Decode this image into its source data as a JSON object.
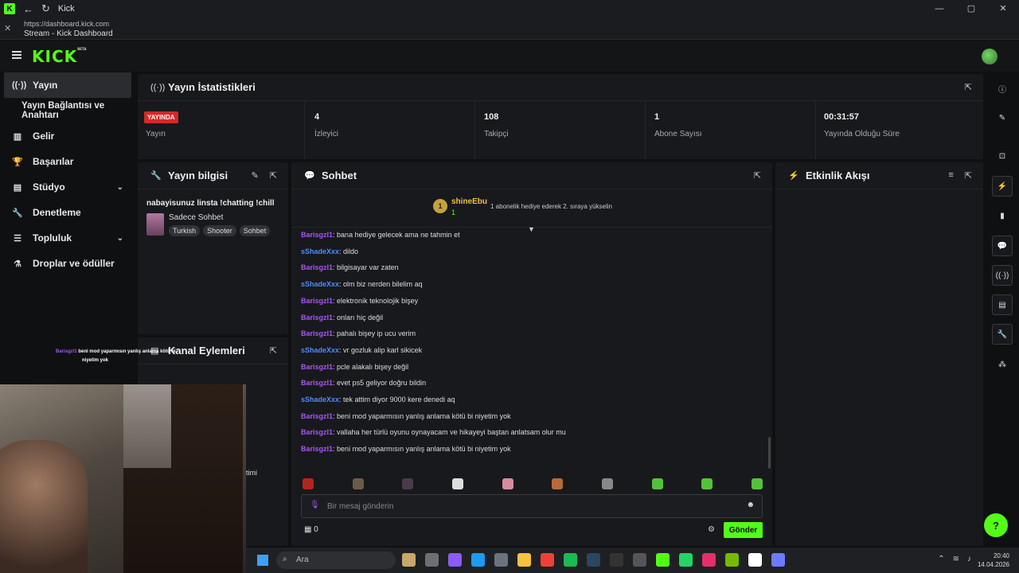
{
  "window": {
    "app_name": "Kick",
    "url": "https://dashboard.kick.com",
    "page_title": "Stream - Kick Dashboard",
    "nav_back": "←",
    "nav_refresh": "↻",
    "close_tab": "✕",
    "btn_min": "—",
    "btn_max": "▢",
    "btn_close": "✕"
  },
  "header": {
    "logo": "KICK",
    "logo_badge": "BETA"
  },
  "sidebar": {
    "items": [
      {
        "icon": "broadcast-icon",
        "glyph": "((·))",
        "label": "Yayın",
        "active": true
      },
      {
        "icon": "",
        "glyph": "",
        "label": "Yayın Bağlantısı ve Anahtarı"
      },
      {
        "icon": "chart-icon",
        "glyph": "▥",
        "label": "Gelir"
      },
      {
        "icon": "trophy-icon",
        "glyph": "🏆",
        "label": "Başarılar"
      },
      {
        "icon": "studio-icon",
        "glyph": "▤",
        "label": "Stüdyo",
        "chevron": "⌄"
      },
      {
        "icon": "wrench-icon",
        "glyph": "🔧",
        "label": "Denetleme"
      },
      {
        "icon": "community-icon",
        "glyph": "☰",
        "label": "Topluluk",
        "chevron": "⌄"
      },
      {
        "icon": "drops-icon",
        "glyph": "⚗",
        "label": "Droplar ve ödüller"
      }
    ]
  },
  "stats_panel": {
    "title": "Yayın İstatistikleri",
    "live_badge": "YAYINDA",
    "stats": [
      {
        "value": "",
        "label": "Yayın"
      },
      {
        "value": "4",
        "label": "İzleyici"
      },
      {
        "value": "108",
        "label": "Takipçi"
      },
      {
        "value": "1",
        "label": "Abone Sayısı"
      },
      {
        "value": "00:31:57",
        "label": "Yayında Olduğu Süre"
      }
    ]
  },
  "info_panel": {
    "title": "Yayın bilgisi",
    "stream_title": "nabayisunuz linsta !chatting !chill",
    "category": "Sadece Sohbet",
    "tags": [
      "Turkish",
      "Shooter",
      "Sohbet"
    ]
  },
  "actions_panel": {
    "title": "Kanal Eylemleri",
    "partial_item": "timi"
  },
  "chat": {
    "title": "Sohbet",
    "pinned": {
      "badge": "1",
      "user": "shineEbu",
      "count": "1",
      "text": "1 abonelik hediye ederek 2. sıraya yükselin"
    },
    "messages": [
      {
        "user": "Barisgzl1",
        "color": "#a855f7",
        "text": "bana hediye gelecek ama ne tahmin et"
      },
      {
        "user": "sShadeXxx",
        "color": "#4f8cff",
        "text": "dildo"
      },
      {
        "user": "Barisgzl1",
        "color": "#a855f7",
        "text": "bilgisayar var zaten"
      },
      {
        "user": "sShadeXxx",
        "color": "#4f8cff",
        "text": "olm biz nerden bilelim aq"
      },
      {
        "user": "Barisgzl1",
        "color": "#a855f7",
        "text": "elektronik teknolojik bişey"
      },
      {
        "user": "Barisgzl1",
        "color": "#a855f7",
        "text": "onları hiç değil"
      },
      {
        "user": "Barisgzl1",
        "color": "#a855f7",
        "text": "pahalı bişey ip ucu verim"
      },
      {
        "user": "sShadeXxx",
        "color": "#4f8cff",
        "text": "vr gozluk alip karl sikicek"
      },
      {
        "user": "Barisgzl1",
        "color": "#a855f7",
        "text": "pcle alakalı bişey değil"
      },
      {
        "user": "Barisgzl1",
        "color": "#a855f7",
        "text": "evet ps5 geliyor doğru bildin"
      },
      {
        "user": "sShadeXxx",
        "color": "#4f8cff",
        "text": "tek attim diyor 9000 kere denedi aq"
      },
      {
        "user": "Barisgzl1",
        "color": "#a855f7",
        "text": "beni mod yaparmısın yanlış anlama kötü bi niyetim yok"
      },
      {
        "user": "Barisgzl1",
        "color": "#a855f7",
        "text": "vallaha her türlü oyunu oynayacam ve hikayeyi baştan anlatsam olur mu"
      },
      {
        "user": "Barisgzl1",
        "color": "#a855f7",
        "text": "beni mod yaparmısın yanlış anlama kötü bi niyetim yok"
      }
    ],
    "emote_colors": [
      "#b3261e",
      "#6b5b4b",
      "#4a3a4a",
      "#dddddd",
      "#d98aa0",
      "#b86a3a",
      "#888888",
      "#53c23a",
      "#53c23a",
      "#53c23a"
    ],
    "input_placeholder": "Bir mesaj gönderin",
    "points": "0",
    "send_label": "Gönder"
  },
  "activity": {
    "title": "Etkinlik Akışı"
  },
  "overlay": {
    "user": "Barisgzl1",
    "text": "beni mod yaparmısın yanlış anlama kötü bi",
    "text2": "niyetim yok"
  },
  "taskbar": {
    "search_placeholder": "Ara",
    "time": "20:40",
    "date": "14.04.2026",
    "app_colors": [
      "#c8a76a",
      "#6d6f73",
      "#8b5cf6",
      "#1d9bf0",
      "#6b7280",
      "#f5c242",
      "#ea4335",
      "#1db954",
      "#2a475e",
      "#333333",
      "#555555",
      "#53fc18",
      "#25d366",
      "#e1306c",
      "#76b900",
      "#ffffff",
      "#6d7bff"
    ]
  },
  "colors": {
    "accent": "#53fc18",
    "live": "#d62828",
    "panel": "#18191c"
  }
}
